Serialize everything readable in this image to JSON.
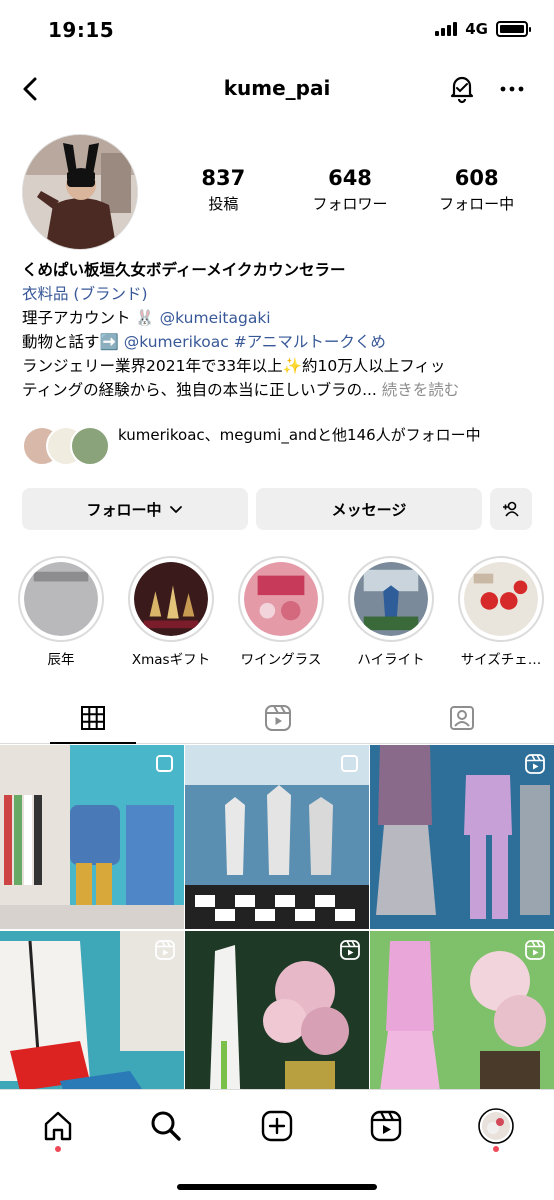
{
  "status_bar": {
    "time": "19:15",
    "network": "4G"
  },
  "nav": {
    "username": "kume_pai"
  },
  "stats": [
    {
      "num": "837",
      "label": "投稿"
    },
    {
      "num": "648",
      "label": "フォロワー"
    },
    {
      "num": "608",
      "label": "フォロー中"
    }
  ],
  "bio": {
    "name": "くめぱい板垣久女ボディーメイクカウンセラー",
    "category": "衣料品 (ブランド)",
    "line1_text": "理子アカウント 🐰 ",
    "line1_link": "@kumeitagaki",
    "line2_text": "動物と話す➡️ ",
    "line2_link1": "@kumerikoac",
    "line2_link2": "#アニマルトークくめ",
    "line3": "ランジェリー業界2021年で33年以上✨約10万人以上フィッ",
    "line4": "ティングの経験から、独自の本当に正しいブラの...",
    "more": " 続きを読む"
  },
  "followed_by": "kumerikoac、megumi_andと他146人がフォロー中",
  "actions": {
    "follow": "フォロー中",
    "message": "メッセージ"
  },
  "highlights": [
    {
      "label": "辰年"
    },
    {
      "label": "Xmasギフト"
    },
    {
      "label": "ワイングラス"
    },
    {
      "label": "ハイライト"
    },
    {
      "label": "サイズチェ…"
    }
  ],
  "colors": {
    "link": "#385898",
    "notification_dot": "#ed4956",
    "button_bg": "#efefef"
  }
}
